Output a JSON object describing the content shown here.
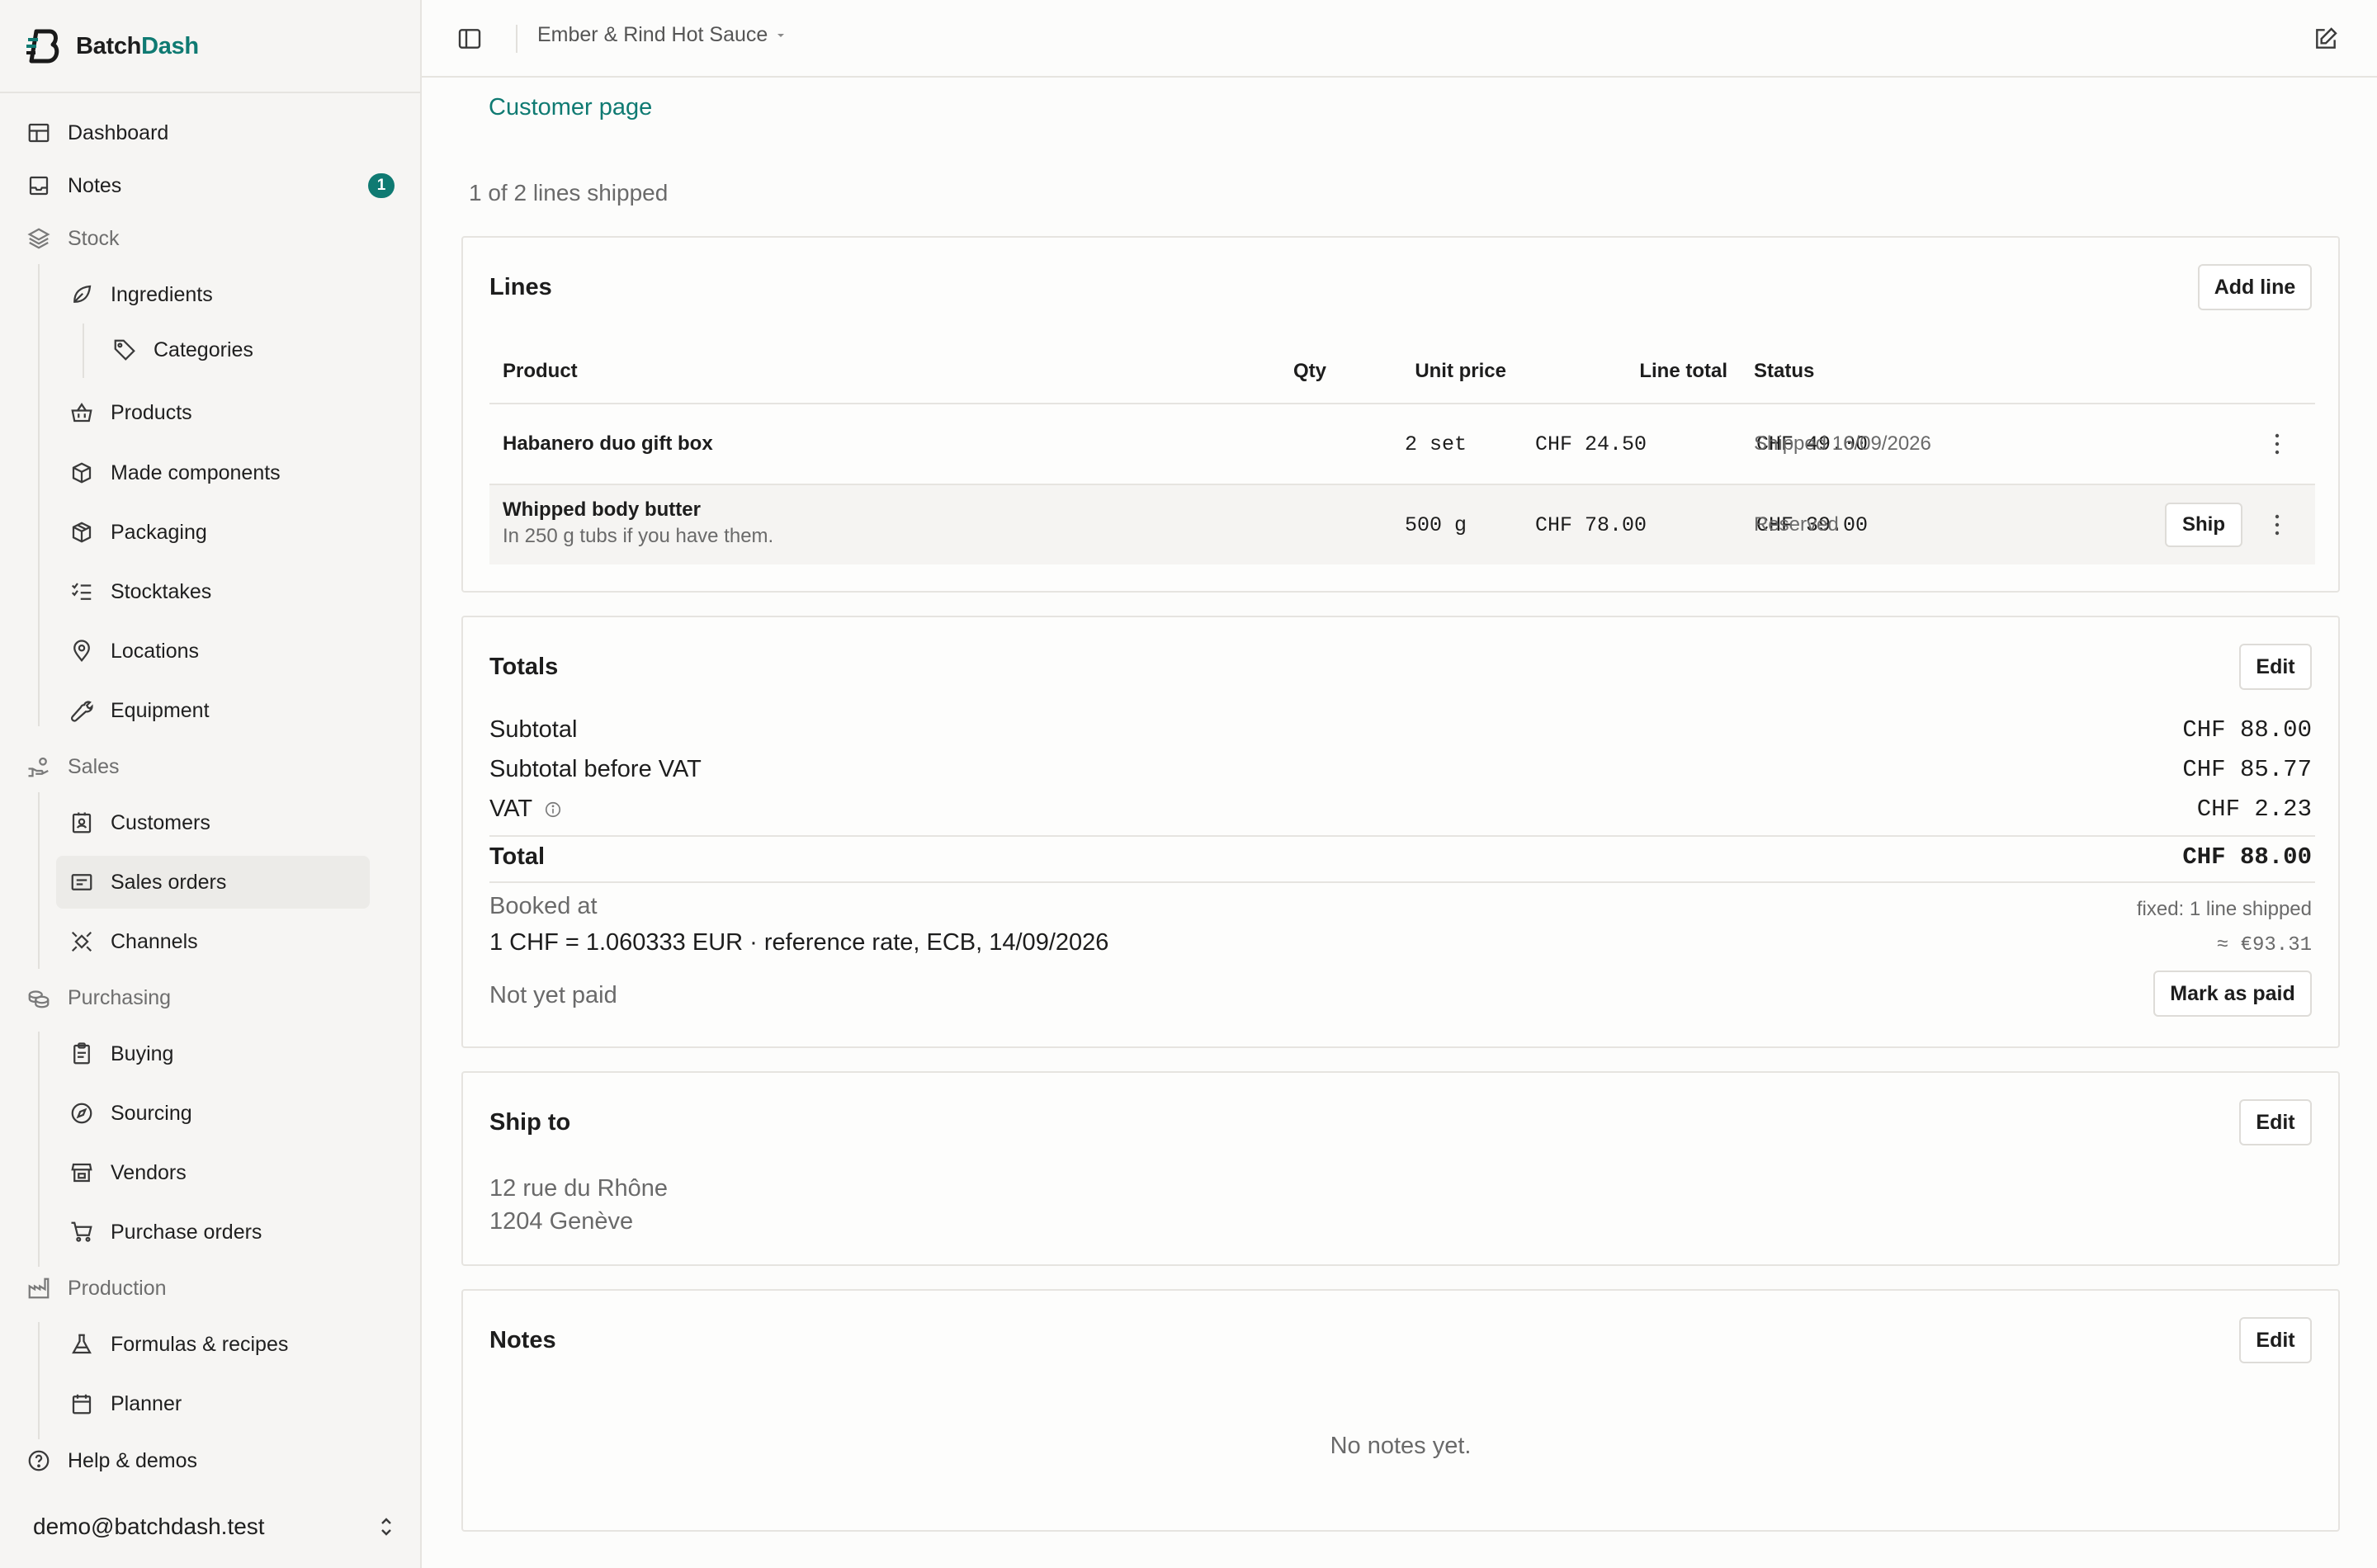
{
  "app": {
    "name_prefix": "Batch",
    "name_accent": "Dash"
  },
  "sidebar": {
    "items": {
      "dashboard": "Dashboard",
      "notes": "Notes",
      "notes_badge": "1",
      "stock": "Stock",
      "ingredients": "Ingredients",
      "categories": "Categories",
      "products": "Products",
      "made_components": "Made components",
      "packaging": "Packaging",
      "stocktakes": "Stocktakes",
      "locations": "Locations",
      "equipment": "Equipment",
      "sales": "Sales",
      "customers": "Customers",
      "sales_orders": "Sales orders",
      "channels": "Channels",
      "purchasing": "Purchasing",
      "buying": "Buying",
      "sourcing": "Sourcing",
      "vendors": "Vendors",
      "purchase_orders": "Purchase orders",
      "production": "Production",
      "formulas": "Formulas & recipes",
      "planner": "Planner",
      "help": "Help & demos"
    },
    "user_email": "demo@batchdash.test"
  },
  "topbar": {
    "workspace": "Ember & Rind Hot Sauce"
  },
  "main": {
    "customer_link": "Customer page",
    "shipped_summary": "1 of 2 lines shipped",
    "lines": {
      "title": "Lines",
      "add_button": "Add line",
      "headers": {
        "product": "Product",
        "qty": "Qty",
        "unit_price": "Unit price",
        "line_total": "Line total",
        "status": "Status"
      },
      "rows": [
        {
          "product": "Habanero duo gift box",
          "note": "",
          "qty": "2 set",
          "unit_price": "CHF 24.50",
          "line_total": "CHF 49.00",
          "status": "Shipped 16/09/2026",
          "action": ""
        },
        {
          "product": "Whipped body butter",
          "note": "In 250 g tubs if you have them.",
          "qty": "500 g",
          "unit_price": "CHF 78.00",
          "line_total": "CHF 39.00",
          "status": "Reserved",
          "action": "Ship"
        }
      ]
    },
    "totals": {
      "title": "Totals",
      "edit_button": "Edit",
      "subtotal_label": "Subtotal",
      "subtotal_value": "CHF 88.00",
      "before_vat_label": "Subtotal before VAT",
      "before_vat_value": "CHF 85.77",
      "vat_label": "VAT",
      "vat_value": "CHF 2.23",
      "total_label": "Total",
      "total_value": "CHF 88.00",
      "booked_label": "Booked at",
      "booked_note": "fixed: 1 line shipped",
      "rate_text": "1 CHF = 1.060333 EUR · reference rate, ECB, 14/09/2026",
      "converted": "≈ €93.31",
      "payment_status": "Not yet paid",
      "mark_paid_button": "Mark as paid"
    },
    "ship_to": {
      "title": "Ship to",
      "edit_button": "Edit",
      "line1": "12 rue du Rhône",
      "line2": "1204 Genève"
    },
    "notes": {
      "title": "Notes",
      "edit_button": "Edit",
      "empty": "No notes yet."
    }
  },
  "colors": {
    "accent": "#0f7a72",
    "sidebar_bg": "#f6f5f3",
    "border": "#e6e4e0"
  }
}
